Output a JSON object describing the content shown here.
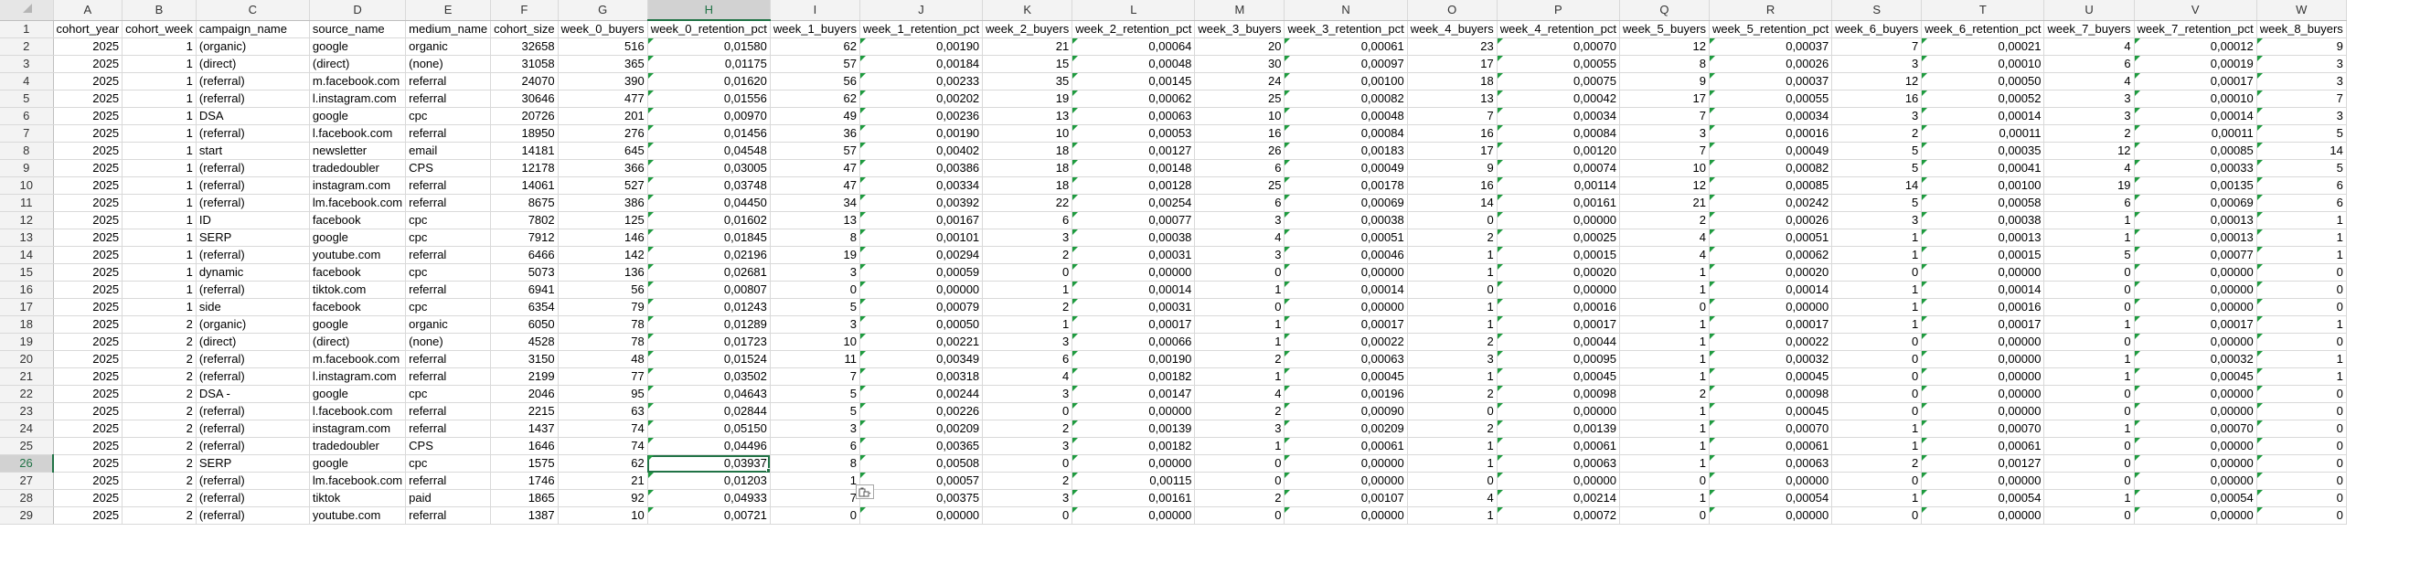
{
  "sheet": {
    "column_letters": [
      "A",
      "B",
      "C",
      "D",
      "E",
      "F",
      "G",
      "H",
      "I",
      "J",
      "K",
      "L",
      "M",
      "N",
      "O",
      "P",
      "Q",
      "R",
      "S",
      "T",
      "U",
      "V",
      "W"
    ],
    "selected_column": "H",
    "selected_row": 26,
    "active_cell": "H26",
    "headers": [
      "cohort_year",
      "cohort_week",
      "campaign_name",
      "source_name",
      "medium_name",
      "cohort_size",
      "week_0_buyers",
      "week_0_retention_pct",
      "week_1_buyers",
      "week_1_retention_pct",
      "week_2_buyers",
      "week_2_retention_pct",
      "week_3_buyers",
      "week_3_retention_pct",
      "week_4_buyers",
      "week_4_retention_pct",
      "week_5_buyers",
      "week_5_retention_pct",
      "week_6_buyers",
      "week_6_retention_pct",
      "week_7_buyers",
      "week_7_retention_pct",
      "week_8_buyers"
    ],
    "rows": [
      [
        "2025",
        "1",
        "(organic)",
        "google",
        "organic",
        "32658",
        "516",
        "0,01580",
        "62",
        "0,00190",
        "21",
        "0,00064",
        "20",
        "0,00061",
        "23",
        "0,00070",
        "12",
        "0,00037",
        "7",
        "0,00021",
        "4",
        "0,00012",
        "9"
      ],
      [
        "2025",
        "1",
        "(direct)",
        "(direct)",
        "(none)",
        "31058",
        "365",
        "0,01175",
        "57",
        "0,00184",
        "15",
        "0,00048",
        "30",
        "0,00097",
        "17",
        "0,00055",
        "8",
        "0,00026",
        "3",
        "0,00010",
        "6",
        "0,00019",
        "3"
      ],
      [
        "2025",
        "1",
        "(referral)",
        "m.facebook.com",
        "referral",
        "24070",
        "390",
        "0,01620",
        "56",
        "0,00233",
        "35",
        "0,00145",
        "24",
        "0,00100",
        "18",
        "0,00075",
        "9",
        "0,00037",
        "12",
        "0,00050",
        "4",
        "0,00017",
        "3"
      ],
      [
        "2025",
        "1",
        "(referral)",
        "l.instagram.com",
        "referral",
        "30646",
        "477",
        "0,01556",
        "62",
        "0,00202",
        "19",
        "0,00062",
        "25",
        "0,00082",
        "13",
        "0,00042",
        "17",
        "0,00055",
        "16",
        "0,00052",
        "3",
        "0,00010",
        "7"
      ],
      [
        "2025",
        "1",
        "DSA",
        "google",
        "cpc",
        "20726",
        "201",
        "0,00970",
        "49",
        "0,00236",
        "13",
        "0,00063",
        "10",
        "0,00048",
        "7",
        "0,00034",
        "7",
        "0,00034",
        "3",
        "0,00014",
        "3",
        "0,00014",
        "3"
      ],
      [
        "2025",
        "1",
        "(referral)",
        "l.facebook.com",
        "referral",
        "18950",
        "276",
        "0,01456",
        "36",
        "0,00190",
        "10",
        "0,00053",
        "16",
        "0,00084",
        "16",
        "0,00084",
        "3",
        "0,00016",
        "2",
        "0,00011",
        "2",
        "0,00011",
        "5"
      ],
      [
        "2025",
        "1",
        "start",
        "newsletter",
        "email",
        "14181",
        "645",
        "0,04548",
        "57",
        "0,00402",
        "18",
        "0,00127",
        "26",
        "0,00183",
        "17",
        "0,00120",
        "7",
        "0,00049",
        "5",
        "0,00035",
        "12",
        "0,00085",
        "14"
      ],
      [
        "2025",
        "1",
        "(referral)",
        "tradedoubler",
        "CPS",
        "12178",
        "366",
        "0,03005",
        "47",
        "0,00386",
        "18",
        "0,00148",
        "6",
        "0,00049",
        "9",
        "0,00074",
        "10",
        "0,00082",
        "5",
        "0,00041",
        "4",
        "0,00033",
        "5"
      ],
      [
        "2025",
        "1",
        "(referral)",
        "instagram.com",
        "referral",
        "14061",
        "527",
        "0,03748",
        "47",
        "0,00334",
        "18",
        "0,00128",
        "25",
        "0,00178",
        "16",
        "0,00114",
        "12",
        "0,00085",
        "14",
        "0,00100",
        "19",
        "0,00135",
        "6"
      ],
      [
        "2025",
        "1",
        "(referral)",
        "lm.facebook.com",
        "referral",
        "8675",
        "386",
        "0,04450",
        "34",
        "0,00392",
        "22",
        "0,00254",
        "6",
        "0,00069",
        "14",
        "0,00161",
        "21",
        "0,00242",
        "5",
        "0,00058",
        "6",
        "0,00069",
        "6"
      ],
      [
        "2025",
        "1",
        "ID",
        "facebook",
        "cpc",
        "7802",
        "125",
        "0,01602",
        "13",
        "0,00167",
        "6",
        "0,00077",
        "3",
        "0,00038",
        "0",
        "0,00000",
        "2",
        "0,00026",
        "3",
        "0,00038",
        "1",
        "0,00013",
        "1"
      ],
      [
        "2025",
        "1",
        "SERP",
        "google",
        "cpc",
        "7912",
        "146",
        "0,01845",
        "8",
        "0,00101",
        "3",
        "0,00038",
        "4",
        "0,00051",
        "2",
        "0,00025",
        "4",
        "0,00051",
        "1",
        "0,00013",
        "1",
        "0,00013",
        "1"
      ],
      [
        "2025",
        "1",
        "(referral)",
        "youtube.com",
        "referral",
        "6466",
        "142",
        "0,02196",
        "19",
        "0,00294",
        "2",
        "0,00031",
        "3",
        "0,00046",
        "1",
        "0,00015",
        "4",
        "0,00062",
        "1",
        "0,00015",
        "5",
        "0,00077",
        "1"
      ],
      [
        "2025",
        "1",
        "dynamic",
        "facebook",
        "cpc",
        "5073",
        "136",
        "0,02681",
        "3",
        "0,00059",
        "0",
        "0,00000",
        "0",
        "0,00000",
        "1",
        "0,00020",
        "1",
        "0,00020",
        "0",
        "0,00000",
        "0",
        "0,00000",
        "0"
      ],
      [
        "2025",
        "1",
        "(referral)",
        "tiktok.com",
        "referral",
        "6941",
        "56",
        "0,00807",
        "0",
        "0,00000",
        "1",
        "0,00014",
        "1",
        "0,00014",
        "0",
        "0,00000",
        "1",
        "0,00014",
        "1",
        "0,00014",
        "0",
        "0,00000",
        "0"
      ],
      [
        "2025",
        "1",
        "side",
        "facebook",
        "cpc",
        "6354",
        "79",
        "0,01243",
        "5",
        "0,00079",
        "2",
        "0,00031",
        "0",
        "0,00000",
        "1",
        "0,00016",
        "0",
        "0,00000",
        "1",
        "0,00016",
        "0",
        "0,00000",
        "0"
      ],
      [
        "2025",
        "2",
        "(organic)",
        "google",
        "organic",
        "6050",
        "78",
        "0,01289",
        "3",
        "0,00050",
        "1",
        "0,00017",
        "1",
        "0,00017",
        "1",
        "0,00017",
        "1",
        "0,00017",
        "1",
        "0,00017",
        "1",
        "0,00017",
        "1"
      ],
      [
        "2025",
        "2",
        "(direct)",
        "(direct)",
        "(none)",
        "4528",
        "78",
        "0,01723",
        "10",
        "0,00221",
        "3",
        "0,00066",
        "1",
        "0,00022",
        "2",
        "0,00044",
        "1",
        "0,00022",
        "0",
        "0,00000",
        "0",
        "0,00000",
        "0"
      ],
      [
        "2025",
        "2",
        "(referral)",
        "m.facebook.com",
        "referral",
        "3150",
        "48",
        "0,01524",
        "11",
        "0,00349",
        "6",
        "0,00190",
        "2",
        "0,00063",
        "3",
        "0,00095",
        "1",
        "0,00032",
        "0",
        "0,00000",
        "1",
        "0,00032",
        "1"
      ],
      [
        "2025",
        "2",
        "(referral)",
        "l.instagram.com",
        "referral",
        "2199",
        "77",
        "0,03502",
        "7",
        "0,00318",
        "4",
        "0,00182",
        "1",
        "0,00045",
        "1",
        "0,00045",
        "1",
        "0,00045",
        "0",
        "0,00000",
        "1",
        "0,00045",
        "1"
      ],
      [
        "2025",
        "2",
        "DSA -",
        "google",
        "cpc",
        "2046",
        "95",
        "0,04643",
        "5",
        "0,00244",
        "3",
        "0,00147",
        "4",
        "0,00196",
        "2",
        "0,00098",
        "2",
        "0,00098",
        "0",
        "0,00000",
        "0",
        "0,00000",
        "0"
      ],
      [
        "2025",
        "2",
        "(referral)",
        "l.facebook.com",
        "referral",
        "2215",
        "63",
        "0,02844",
        "5",
        "0,00226",
        "0",
        "0,00000",
        "2",
        "0,00090",
        "0",
        "0,00000",
        "1",
        "0,00045",
        "0",
        "0,00000",
        "0",
        "0,00000",
        "0"
      ],
      [
        "2025",
        "2",
        "(referral)",
        "instagram.com",
        "referral",
        "1437",
        "74",
        "0,05150",
        "3",
        "0,00209",
        "2",
        "0,00139",
        "3",
        "0,00209",
        "2",
        "0,00139",
        "1",
        "0,00070",
        "1",
        "0,00070",
        "1",
        "0,00070",
        "0"
      ],
      [
        "2025",
        "2",
        "(referral)",
        "tradedoubler",
        "CPS",
        "1646",
        "74",
        "0,04496",
        "6",
        "0,00365",
        "3",
        "0,00182",
        "1",
        "0,00061",
        "1",
        "0,00061",
        "1",
        "0,00061",
        "1",
        "0,00061",
        "0",
        "0,00000",
        "0"
      ],
      [
        "2025",
        "2",
        "SERP",
        "google",
        "cpc",
        "1575",
        "62",
        "0,03937",
        "8",
        "0,00508",
        "0",
        "0,00000",
        "0",
        "0,00000",
        "1",
        "0,00063",
        "1",
        "0,00063",
        "2",
        "0,00127",
        "0",
        "0,00000",
        "0"
      ],
      [
        "2025",
        "2",
        "(referral)",
        "lm.facebook.com",
        "referral",
        "1746",
        "21",
        "0,01203",
        "1",
        "0,00057",
        "2",
        "0,00115",
        "0",
        "0,00000",
        "0",
        "0,00000",
        "0",
        "0,00000",
        "0",
        "0,00000",
        "0",
        "0,00000",
        "0"
      ],
      [
        "2025",
        "2",
        "(referral)",
        "tiktok",
        "paid",
        "1865",
        "92",
        "0,04933",
        "7",
        "0,00375",
        "3",
        "0,00161",
        "2",
        "0,00107",
        "4",
        "0,00214",
        "1",
        "0,00054",
        "1",
        "0,00054",
        "1",
        "0,00054",
        "0"
      ],
      [
        "2025",
        "2",
        "(referral)",
        "youtube.com",
        "referral",
        "1387",
        "10",
        "0,00721",
        "0",
        "0,00000",
        "0",
        "0,00000",
        "0",
        "0,00000",
        "1",
        "0,00072",
        "0",
        "0,00000",
        "0",
        "0,00000",
        "0",
        "0,00000",
        "0"
      ]
    ]
  },
  "icons": {
    "corner": "select-all-icon",
    "paste": "paste-options-icon"
  },
  "colors": {
    "accent": "#217346",
    "error_flag": "#1e9b3f",
    "grid": "#d9d9d9",
    "header_bg": "#f3f3f3"
  }
}
